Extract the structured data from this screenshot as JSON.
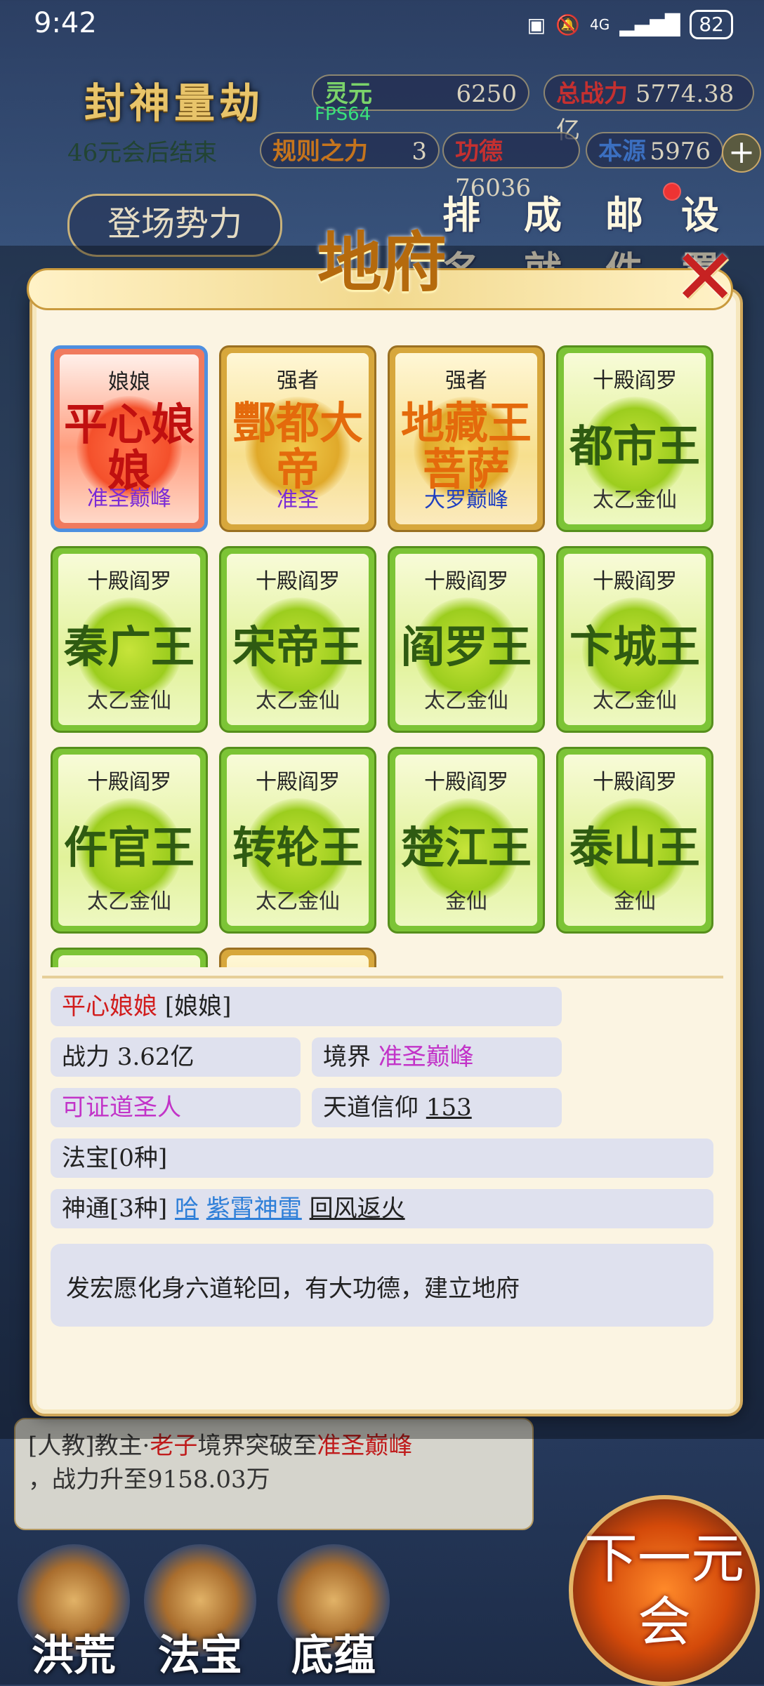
{
  "status": {
    "time": "9:42",
    "net": "4G",
    "battery": "82"
  },
  "hud": {
    "title": "封神量劫",
    "subtitle": "46元会后结束",
    "lingyuan_label": "灵元",
    "lingyuan": "6250",
    "zhanli_label": "总战力",
    "zhanli": "5774.38亿",
    "fps": "FPS64",
    "guize_label": "规则之力",
    "guize": "3",
    "gongde_label": "功德",
    "gongde": "76036",
    "benyuan_label": "本源",
    "benyuan": "5976",
    "plus": "+",
    "login": "登场势力",
    "tabs": [
      "排名",
      "成就",
      "邮件",
      "设置"
    ]
  },
  "log": {
    "line1_pre": "[人教]教主·",
    "line1_name": "老子",
    "line1_mid": "境界突破至",
    "line1_rank": "准圣巅峰",
    "line2": "，战力升至9158.03万"
  },
  "bottom_nav": [
    "洪荒",
    "法宝",
    "底蕴"
  ],
  "next_btn": "下一元会",
  "modal": {
    "title": "地府",
    "close": "✕",
    "cards": [
      {
        "top": "娘娘",
        "name": "平心娘娘",
        "rank": "准圣巅峰",
        "style": "red",
        "rank_color": "purple"
      },
      {
        "top": "强者",
        "name": "酆都大帝",
        "rank": "准圣",
        "style": "gold",
        "rank_color": "purple"
      },
      {
        "top": "强者",
        "name": "地藏王菩萨",
        "rank": "大罗巅峰",
        "style": "gold",
        "rank_color": "blue"
      },
      {
        "top": "十殿阎罗",
        "name": "都市王",
        "rank": "太乙金仙",
        "style": "green"
      },
      {
        "top": "十殿阎罗",
        "name": "秦广王",
        "rank": "太乙金仙",
        "style": "green"
      },
      {
        "top": "十殿阎罗",
        "name": "宋帝王",
        "rank": "太乙金仙",
        "style": "green"
      },
      {
        "top": "十殿阎罗",
        "name": "阎罗王",
        "rank": "太乙金仙",
        "style": "green"
      },
      {
        "top": "十殿阎罗",
        "name": "卞城王",
        "rank": "太乙金仙",
        "style": "green"
      },
      {
        "top": "十殿阎罗",
        "name": "仵官王",
        "rank": "太乙金仙",
        "style": "green"
      },
      {
        "top": "十殿阎罗",
        "name": "转轮王",
        "rank": "太乙金仙",
        "style": "green"
      },
      {
        "top": "十殿阎罗",
        "name": "楚江王",
        "rank": "金仙",
        "style": "green"
      },
      {
        "top": "十殿阎罗",
        "name": "泰山王",
        "rank": "金仙",
        "style": "green"
      },
      {
        "top": "",
        "name": "",
        "rank": "",
        "style": "green"
      },
      {
        "top": "",
        "name": "",
        "rank": "",
        "style": "gold"
      }
    ],
    "detail": {
      "name": "平心娘娘",
      "title_tag": "[娘娘]",
      "power_label": "战力",
      "power": "3.62亿",
      "realm_label": "境界",
      "realm": "准圣巅峰",
      "status": "可证道圣人",
      "faith_label": "天道信仰",
      "faith": "153",
      "treasure": "法宝[0种]",
      "skills_label": "神通[3种]",
      "skills": [
        "哈",
        "紫霄神雷",
        "回风返火"
      ],
      "description": "发宏愿化身六道轮回，有大功德，建立地府"
    }
  }
}
